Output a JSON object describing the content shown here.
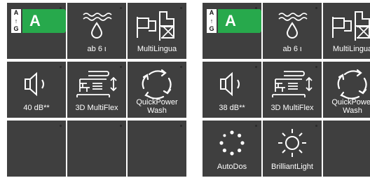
{
  "panels": [
    {
      "tiles": [
        {
          "kind": "energy",
          "scale_top": "A",
          "scale_arrow": "↑",
          "scale_bottom": "G",
          "rating": "A",
          "label": ""
        },
        {
          "kind": "water",
          "icon": "water-drop-icon",
          "label": "ab 6 ι"
        },
        {
          "kind": "language",
          "icon": "flags-icon",
          "label": "MultiLingua"
        },
        {
          "kind": "noise",
          "icon": "speaker-icon",
          "label": "40 dB**"
        },
        {
          "kind": "multiflex",
          "icon": "basket-drawer-icon",
          "label": "3D MultiFlex"
        },
        {
          "kind": "quickpower",
          "icon": "cycle-arrows-icon",
          "label": "QuickPower Wash"
        },
        {
          "kind": "empty",
          "label": ""
        },
        {
          "kind": "empty",
          "label": ""
        },
        {
          "kind": "empty",
          "label": ""
        }
      ]
    },
    {
      "tiles": [
        {
          "kind": "energy",
          "scale_top": "A",
          "scale_arrow": "↑",
          "scale_bottom": "G",
          "rating": "A",
          "label": ""
        },
        {
          "kind": "water",
          "icon": "water-drop-icon",
          "label": "ab 6 ι"
        },
        {
          "kind": "language",
          "icon": "flags-icon",
          "label": "MultiLingua"
        },
        {
          "kind": "noise",
          "icon": "speaker-icon",
          "label": "38 dB**"
        },
        {
          "kind": "multiflex",
          "icon": "basket-drawer-icon",
          "label": "3D MultiFlex"
        },
        {
          "kind": "quickpower",
          "icon": "cycle-arrows-icon",
          "label": "QuickPower Wash"
        },
        {
          "kind": "autodos",
          "icon": "dotted-circle-icon",
          "label": "AutoDos"
        },
        {
          "kind": "brilliant",
          "icon": "sun-light-icon",
          "label": "BrilliantLight"
        },
        {
          "kind": "empty",
          "label": ""
        }
      ]
    }
  ],
  "colors": {
    "tile": "#3f3f3f",
    "energy_green": "#27a94c",
    "icon": "#ffffff"
  }
}
